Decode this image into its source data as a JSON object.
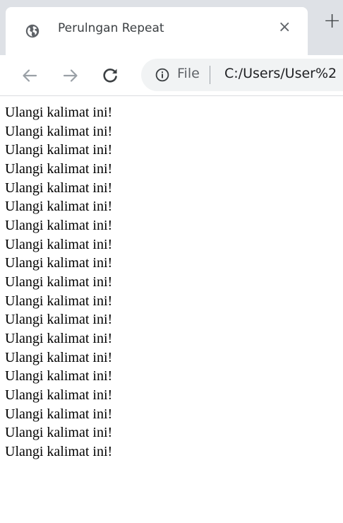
{
  "tab": {
    "title": "Perulngan Repeat",
    "close_glyph": "×",
    "favicon": "globe-icon"
  },
  "toolbar": {
    "new_tab_glyph": "+",
    "back_icon": "arrow-left-icon",
    "forward_icon": "arrow-right-icon",
    "reload_icon": "reload-icon"
  },
  "omnibox": {
    "security_icon": "info-icon",
    "scheme_label": "File",
    "url": "C:/Users/User%2"
  },
  "page": {
    "lines": [
      "Ulangi kalimat ini!",
      "Ulangi kalimat ini!",
      "Ulangi kalimat ini!",
      "Ulangi kalimat ini!",
      "Ulangi kalimat ini!",
      "Ulangi kalimat ini!",
      "Ulangi kalimat ini!",
      "Ulangi kalimat ini!",
      "Ulangi kalimat ini!",
      "Ulangi kalimat ini!",
      "Ulangi kalimat ini!",
      "Ulangi kalimat ini!",
      "Ulangi kalimat ini!",
      "Ulangi kalimat ini!",
      "Ulangi kalimat ini!",
      "Ulangi kalimat ini!",
      "Ulangi kalimat ini!",
      "Ulangi kalimat ini!",
      "Ulangi kalimat ini!"
    ]
  }
}
